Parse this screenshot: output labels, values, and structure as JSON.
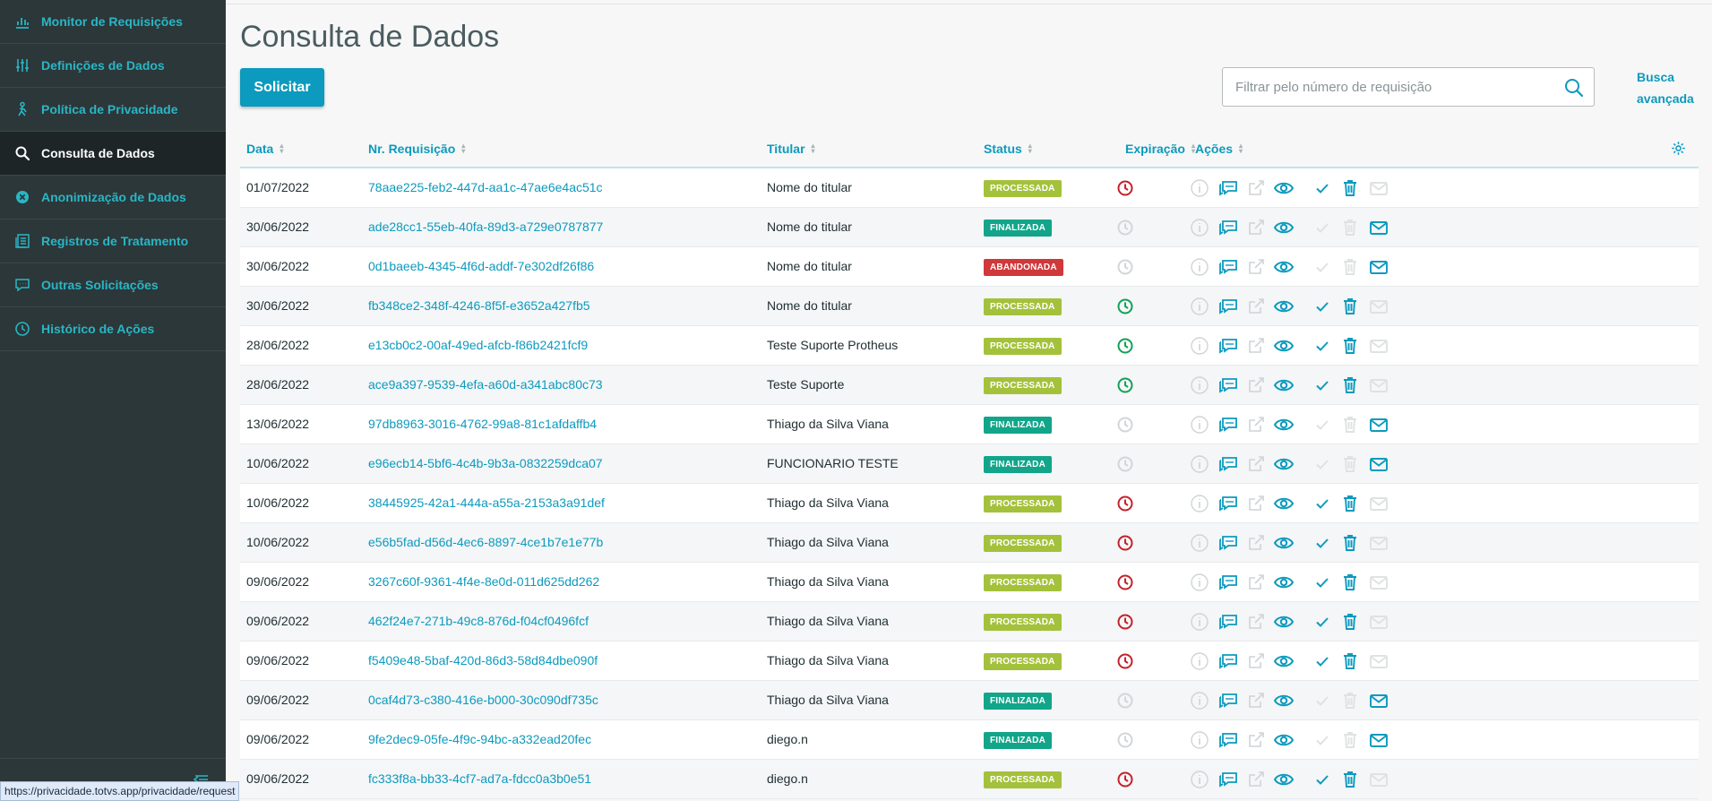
{
  "sidebar": {
    "items": [
      {
        "label": "Monitor de Requisições",
        "icon": "bar-chart-icon",
        "active": false
      },
      {
        "label": "Definições de Dados",
        "icon": "sliders-icon",
        "active": false
      },
      {
        "label": "Política de Privacidade",
        "icon": "person-walking-icon",
        "active": false
      },
      {
        "label": "Consulta de Dados",
        "icon": "search-icon",
        "active": true
      },
      {
        "label": "Anonimização de Dados",
        "icon": "x-circle-icon",
        "active": false
      },
      {
        "label": "Registros de Tratamento",
        "icon": "document-list-icon",
        "active": false
      },
      {
        "label": "Outras Solicitações",
        "icon": "chat-icon",
        "active": false
      },
      {
        "label": "Histórico de Ações",
        "icon": "clock-icon",
        "active": false
      }
    ]
  },
  "status_url": "https://privacidade.totvs.app/privacidade/request",
  "page_title": "Consulta de Dados",
  "request_button": "Solicitar",
  "search": {
    "placeholder": "Filtrar pelo número de requisição",
    "value": ""
  },
  "advanced_search": "Busca avançada",
  "table": {
    "columns": [
      "Data",
      "Nr. Requisição",
      "Titular",
      "Status",
      "Expiração",
      "Ações"
    ],
    "rows": [
      {
        "date": "01/07/2022",
        "id": "78aae225-feb2-447d-aa1c-47ae6e4ac51c",
        "holder": "Nome do titular",
        "status": "PROCESSADA",
        "expiration": "red",
        "done": false
      },
      {
        "date": "30/06/2022",
        "id": "ade28cc1-55eb-40fa-89d3-a729e0787877",
        "holder": "Nome do titular",
        "status": "FINALIZADA",
        "expiration": "gray",
        "done": true
      },
      {
        "date": "30/06/2022",
        "id": "0d1baeeb-4345-4f6d-addf-7e302df26f86",
        "holder": "Nome do titular",
        "status": "ABANDONADA",
        "expiration": "gray",
        "done": true
      },
      {
        "date": "30/06/2022",
        "id": "fb348ce2-348f-4246-8f5f-e3652a427fb5",
        "holder": "Nome do titular",
        "status": "PROCESSADA",
        "expiration": "green",
        "done": false
      },
      {
        "date": "28/06/2022",
        "id": "e13cb0c2-00af-49ed-afcb-f86b2421fcf9",
        "holder": "Teste Suporte Protheus",
        "status": "PROCESSADA",
        "expiration": "green",
        "done": false
      },
      {
        "date": "28/06/2022",
        "id": "ace9a397-9539-4efa-a60d-a341abc80c73",
        "holder": "Teste Suporte",
        "status": "PROCESSADA",
        "expiration": "green",
        "done": false
      },
      {
        "date": "13/06/2022",
        "id": "97db8963-3016-4762-99a8-81c1afdaffb4",
        "holder": "Thiago da Silva Viana",
        "status": "FINALIZADA",
        "expiration": "gray",
        "done": true
      },
      {
        "date": "10/06/2022",
        "id": "e96ecb14-5bf6-4c4b-9b3a-0832259dca07",
        "holder": "FUNCIONARIO TESTE",
        "status": "FINALIZADA",
        "expiration": "gray",
        "done": true
      },
      {
        "date": "10/06/2022",
        "id": "38445925-42a1-444a-a55a-2153a3a91def",
        "holder": "Thiago da Silva Viana",
        "status": "PROCESSADA",
        "expiration": "red",
        "done": false
      },
      {
        "date": "10/06/2022",
        "id": "e56b5fad-d56d-4ec6-8897-4ce1b7e1e77b",
        "holder": "Thiago da Silva Viana",
        "status": "PROCESSADA",
        "expiration": "red",
        "done": false
      },
      {
        "date": "09/06/2022",
        "id": "3267c60f-9361-4f4e-8e0d-011d625dd262",
        "holder": "Thiago da Silva Viana",
        "status": "PROCESSADA",
        "expiration": "red",
        "done": false
      },
      {
        "date": "09/06/2022",
        "id": "462f24e7-271b-49c8-876d-f04cf0496fcf",
        "holder": "Thiago da Silva Viana",
        "status": "PROCESSADA",
        "expiration": "red",
        "done": false
      },
      {
        "date": "09/06/2022",
        "id": "f5409e48-5baf-420d-86d3-58d84dbe090f",
        "holder": "Thiago da Silva Viana",
        "status": "PROCESSADA",
        "expiration": "red",
        "done": false
      },
      {
        "date": "09/06/2022",
        "id": "0caf4d73-c380-416e-b000-30c090df735c",
        "holder": "Thiago da Silva Viana",
        "status": "FINALIZADA",
        "expiration": "gray",
        "done": true
      },
      {
        "date": "09/06/2022",
        "id": "9fe2dec9-05fe-4f9c-94bc-a332ead20fec",
        "holder": "diego.n",
        "status": "FINALIZADA",
        "expiration": "gray",
        "done": true
      },
      {
        "date": "09/06/2022",
        "id": "fc333f8a-bb33-4cf7-ad7a-fdcc0a3b0e51",
        "holder": "diego.n",
        "status": "PROCESSADA",
        "expiration": "red",
        "done": false
      }
    ]
  },
  "colors": {
    "accent": "#0c9abe",
    "sidebar_bg": "#2c3739",
    "processada": "#a4c13c",
    "finalizada": "#12a58a",
    "abandonada": "#d0383a",
    "exp_red": "#c4222a",
    "exp_green": "#12a058",
    "exp_gray": "#d2d6d8"
  }
}
